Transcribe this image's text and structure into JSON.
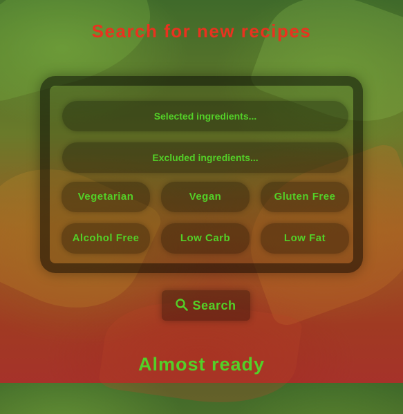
{
  "header": {
    "title": "Search for new recipes"
  },
  "search_form": {
    "selected_placeholder": "Selected ingredients...",
    "excluded_placeholder": "Excluded ingredients...",
    "filters": [
      "Vegetarian",
      "Vegan",
      "Gluten Free",
      "Alcohol Free",
      "Low Carb",
      "Low Fat"
    ],
    "search_label": "Search",
    "search_icon": "search-icon"
  },
  "status": {
    "text": "Almost ready"
  },
  "colors": {
    "title": "#e9321f",
    "accent": "#53d028"
  }
}
